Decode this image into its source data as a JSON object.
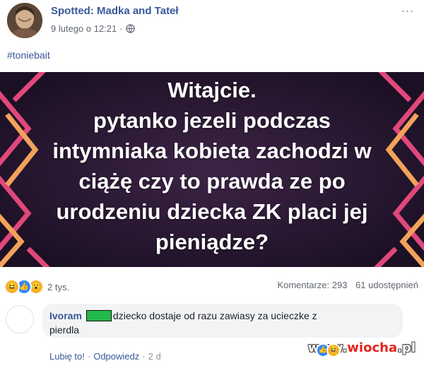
{
  "post": {
    "page_name": "Spotted: Madka and Tateł",
    "date": "9 lutego o 12:21",
    "date_separator": "·",
    "more": "...",
    "hashtag": "#toniebait",
    "image_text": [
      "Witajcie.",
      "pytanko jezeli podczas",
      "intymniaka kobieta zachodzi w",
      "ciążę czy to prawda ze po",
      "urodzeniu dziecka ZK placi jej",
      "pieniądze?"
    ]
  },
  "stats": {
    "reaction_icons": [
      "haha-icon",
      "like-icon",
      "wow-icon"
    ],
    "reaction_count": "2 tys.",
    "comments": "Komentarze: 293",
    "shares": "61 udostępnień"
  },
  "comment": {
    "author": "Ivoram",
    "text_line1": "dziecko dostaje od razu zawiasy za ucieczke z",
    "text_line2": "pierdla",
    "like_label": "Lubię to!",
    "reply_label": "Odpowiedz",
    "separator": "·",
    "time": "2 d"
  },
  "watermark": {
    "prefix": "www.",
    "brand": "wiocha",
    "suffix": ".pl"
  },
  "colors": {
    "link_blue": "#385898",
    "image_background": "#2a1830",
    "redaction_green": "#23b84a"
  }
}
